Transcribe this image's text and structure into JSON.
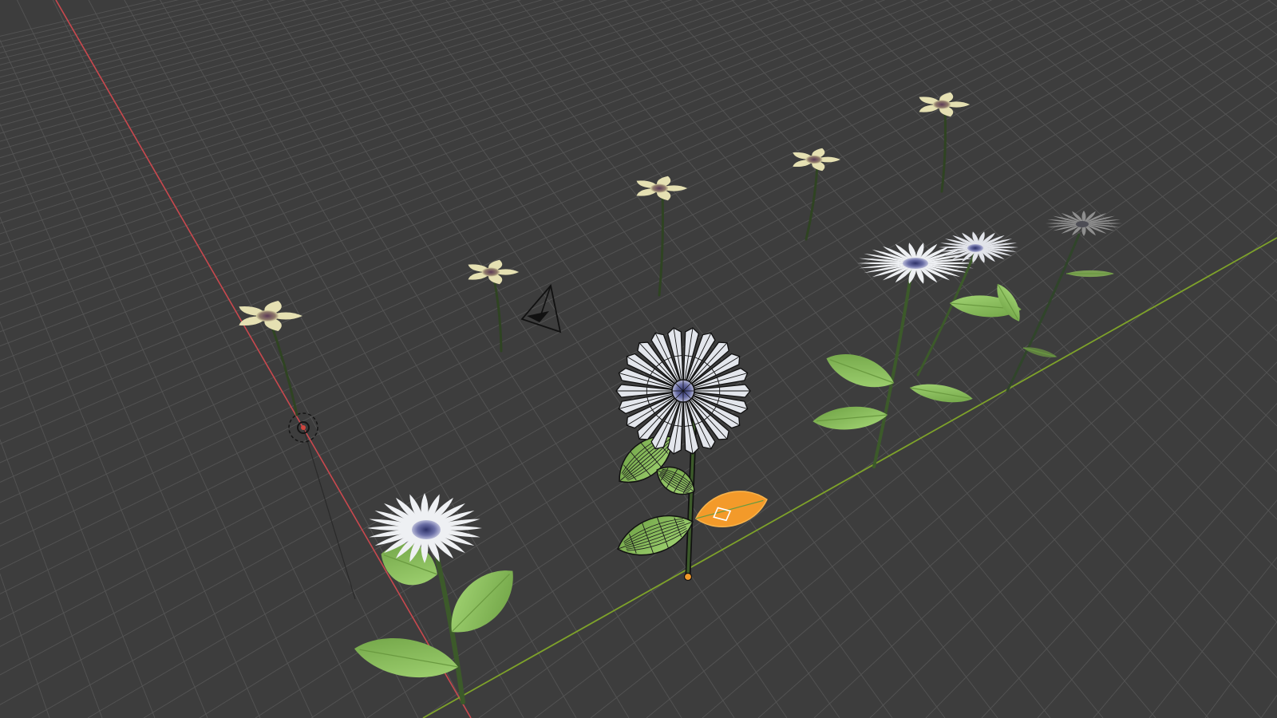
{
  "app": "3D Viewport",
  "colors": {
    "background": "#3d3d3d",
    "grid": "#545454",
    "x_axis": "#c9484e",
    "y_axis": "#7ea22a",
    "petal_white": "#eef0f3",
    "petal_cream": "#e5e0b2",
    "flower_center": "#6b6fa6",
    "leaf": "#8fc45f",
    "stem": "#3c5a2a",
    "selection_active": "#f39a2a",
    "wire_outline": "#111111"
  },
  "scene": {
    "objects": [
      {
        "type": "cream-flower",
        "label": "cream-flower-1"
      },
      {
        "type": "cream-flower",
        "label": "cream-flower-2"
      },
      {
        "type": "cream-flower",
        "label": "cream-flower-3"
      },
      {
        "type": "cream-flower",
        "label": "cream-flower-4"
      },
      {
        "type": "cream-flower",
        "label": "cream-flower-5"
      },
      {
        "type": "daisy",
        "label": "daisy-front-left"
      },
      {
        "type": "daisy",
        "label": "daisy-selected",
        "mode": "edit-wireframe",
        "selected": true
      },
      {
        "type": "daisy",
        "label": "daisy-back-right-1"
      },
      {
        "type": "daisy",
        "label": "daisy-back-right-2"
      },
      {
        "type": "daisy",
        "label": "daisy-back-right-3-dim"
      }
    ],
    "icons": [
      "camera-icon",
      "light-icon",
      "origin-point-icon"
    ]
  }
}
